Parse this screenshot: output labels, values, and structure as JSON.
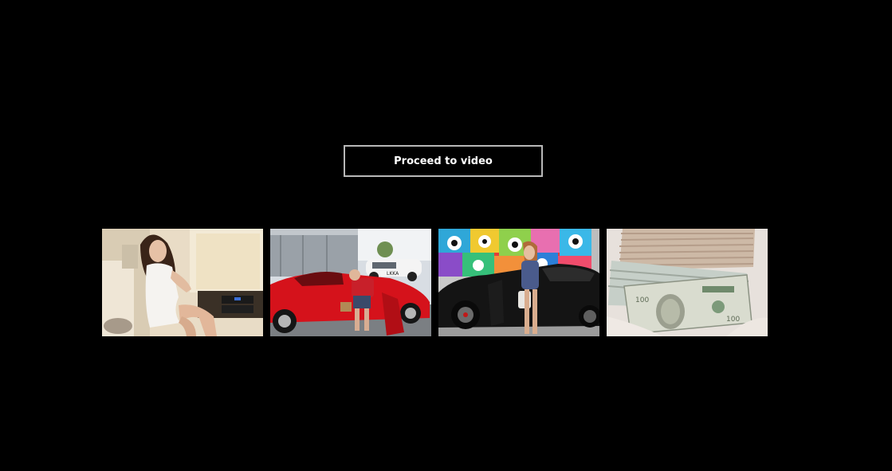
{
  "main": {
    "proceed_button_label": "Proceed to video"
  },
  "thumbnails": [
    {
      "name": "thumb-woman-car-interior"
    },
    {
      "name": "thumb-red-sports-car"
    },
    {
      "name": "thumb-woman-black-car-mural"
    },
    {
      "name": "thumb-cash-stack"
    }
  ],
  "colors": {
    "background": "#000000",
    "button_border": "#b8b8b8",
    "button_text": "#ffffff"
  }
}
